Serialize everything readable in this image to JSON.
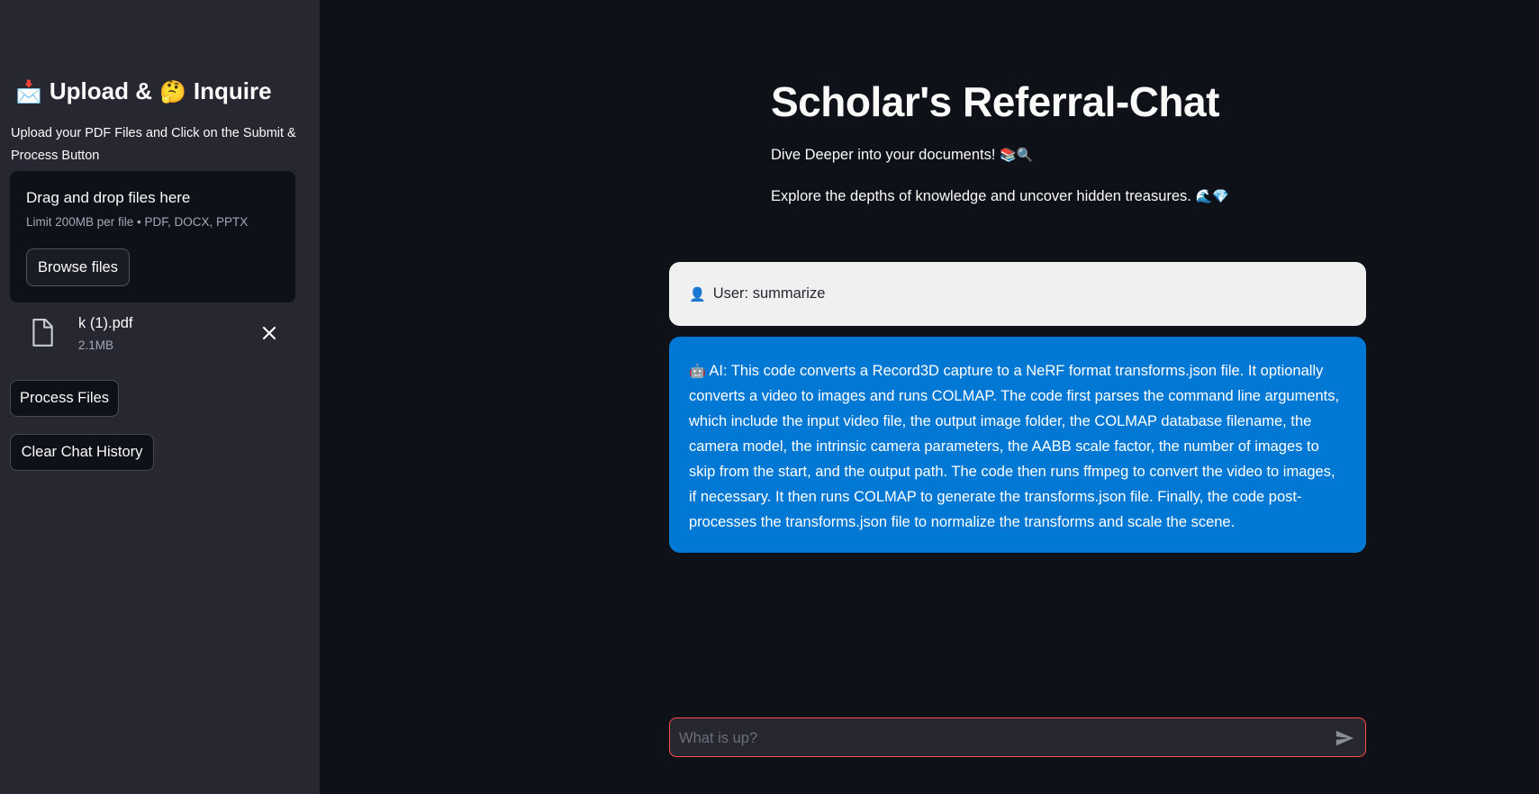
{
  "sidebar": {
    "title_icon_1": "📩",
    "title_part_1": "Upload &",
    "title_icon_2": "🤔",
    "title_part_2": "Inquire",
    "subtitle": "Upload your PDF Files and Click on the Submit & Process Button",
    "dropzone": {
      "title": "Drag and drop files here",
      "limit": "Limit 200MB per file • PDF, DOCX, PPTX",
      "browse_label": "Browse files"
    },
    "file": {
      "name": "k (1).pdf",
      "size": "2.1MB"
    },
    "process_label": "Process Files",
    "clear_label": "Clear Chat History"
  },
  "main": {
    "title": "Scholar's Referral-Chat",
    "tagline": "Dive Deeper into your documents!",
    "tagline_emoji": "📚🔍",
    "subtitle": "Explore the depths of knowledge and uncover hidden treasures.",
    "subtitle_emoji": "🌊💎"
  },
  "chat": {
    "user_icon": "👤",
    "user_message": "User: summarize",
    "ai_icon": "🤖",
    "ai_message": "AI: This code converts a Record3D capture to a NeRF format transforms.json file. It optionally converts a video to images and runs COLMAP. The code first parses the command line arguments, which include the input video file, the output image folder, the COLMAP database filename, the camera model, the intrinsic camera parameters, the AABB scale factor, the number of images to skip from the start, and the output path. The code then runs ffmpeg to convert the video to images, if necessary. It then runs COLMAP to generate the transforms.json file. Finally, the code post-processes the transforms.json file to normalize the transforms and scale the scene."
  },
  "input": {
    "placeholder": "What is up?",
    "value": ""
  },
  "colors": {
    "sidebar_bg": "#262730",
    "main_bg": "#0e1117",
    "ai_bubble": "#0078d4",
    "user_bubble": "#f0f0f0",
    "input_border": "#ff4b4b"
  }
}
